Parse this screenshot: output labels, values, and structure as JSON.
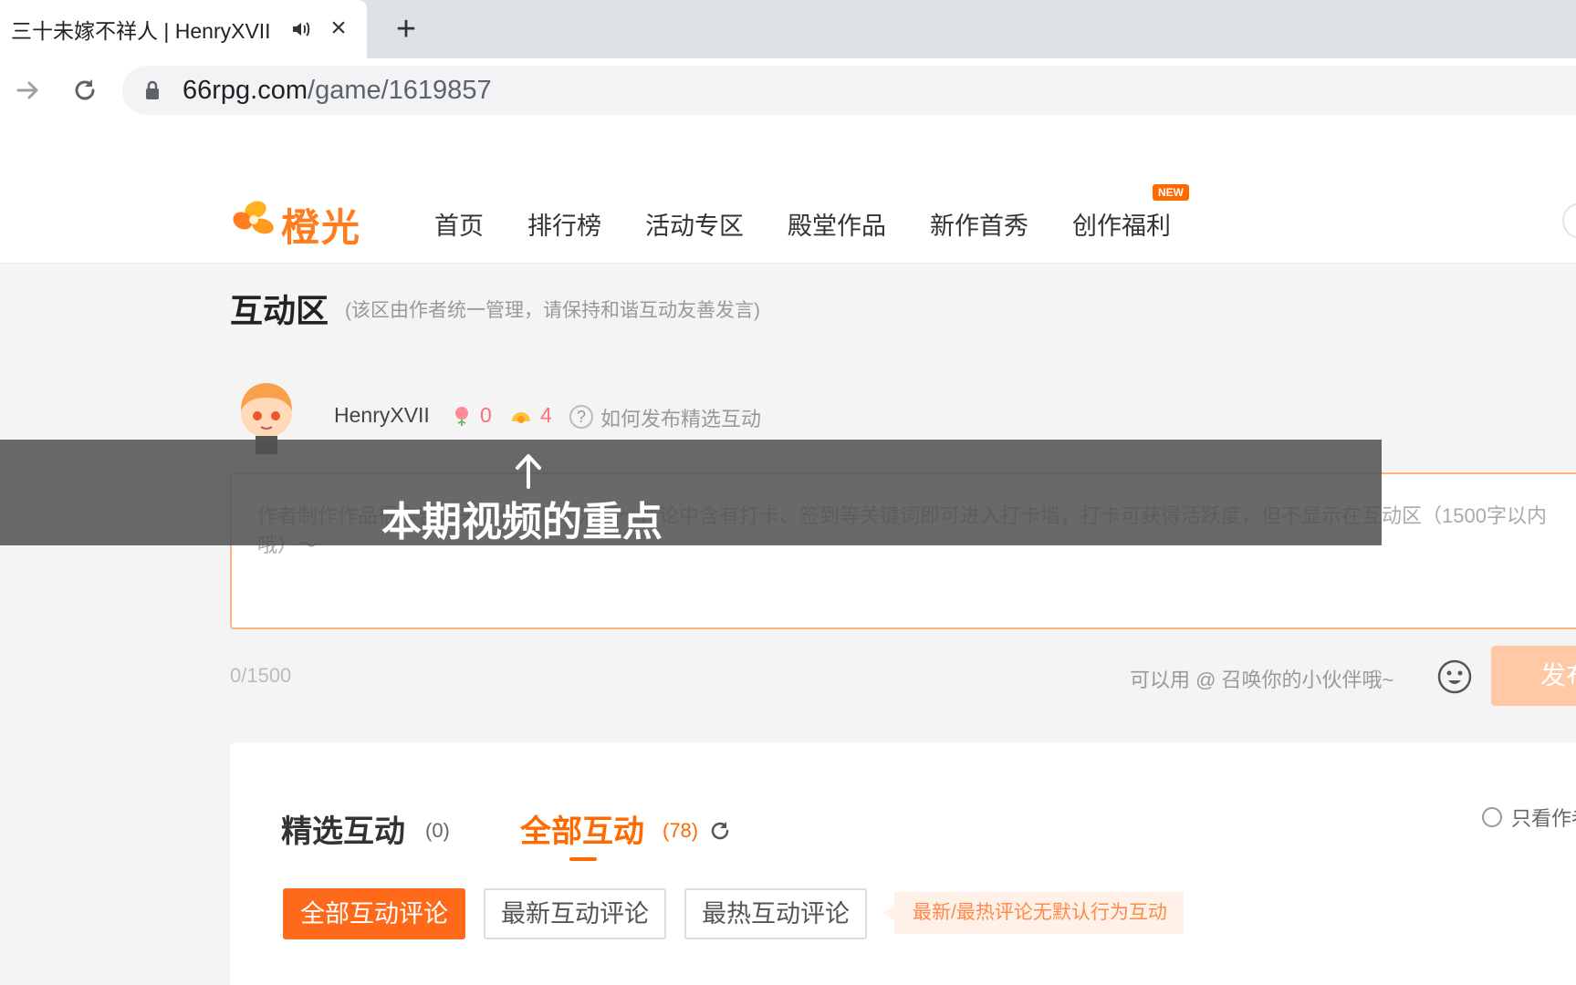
{
  "browser": {
    "tab_title": "三十未嫁不祥人 | HenryXVII",
    "url_host": "66rpg.com",
    "url_path": "/game/1619857"
  },
  "site": {
    "logo_text": "橙光",
    "nav": [
      "首页",
      "排行榜",
      "活动专区",
      "殿堂作品",
      "新作首秀",
      "创作福利"
    ],
    "new_badge": "NEW"
  },
  "interaction": {
    "title": "互动区",
    "note": "(该区由作者统一管理，请保持和谐互动友善发言)",
    "username": "HenryXVII",
    "flower_count": "0",
    "sun_count": "4",
    "help_text": "如何发布精选互动",
    "editor_placeholder": "作者制作作品很辛苦，来给作者加个油吧～评论中含有打卡、签到等关键词即可进入打卡墙，打卡可获得活跃度，但不显示在互动区（1500字以内哦）～",
    "char_count": "0/1500",
    "mention_hint": "可以用 @ 召唤你的小伙伴哦~",
    "publish_label": "发布"
  },
  "comments": {
    "tab_featured": "精选互动",
    "tab_featured_count": "(0)",
    "tab_all": "全部互动",
    "tab_all_count": "(78)",
    "author_only": "只看作者",
    "filter_all": "全部互动评论",
    "filter_new": "最新互动评论",
    "filter_hot": "最热互动评论",
    "filter_note": "最新/最热评论无默认行为互动"
  },
  "overlay": {
    "caption": "本期视频的重点"
  },
  "colors": {
    "brand": "#ff6a00",
    "overlay_bg": "#505050"
  }
}
